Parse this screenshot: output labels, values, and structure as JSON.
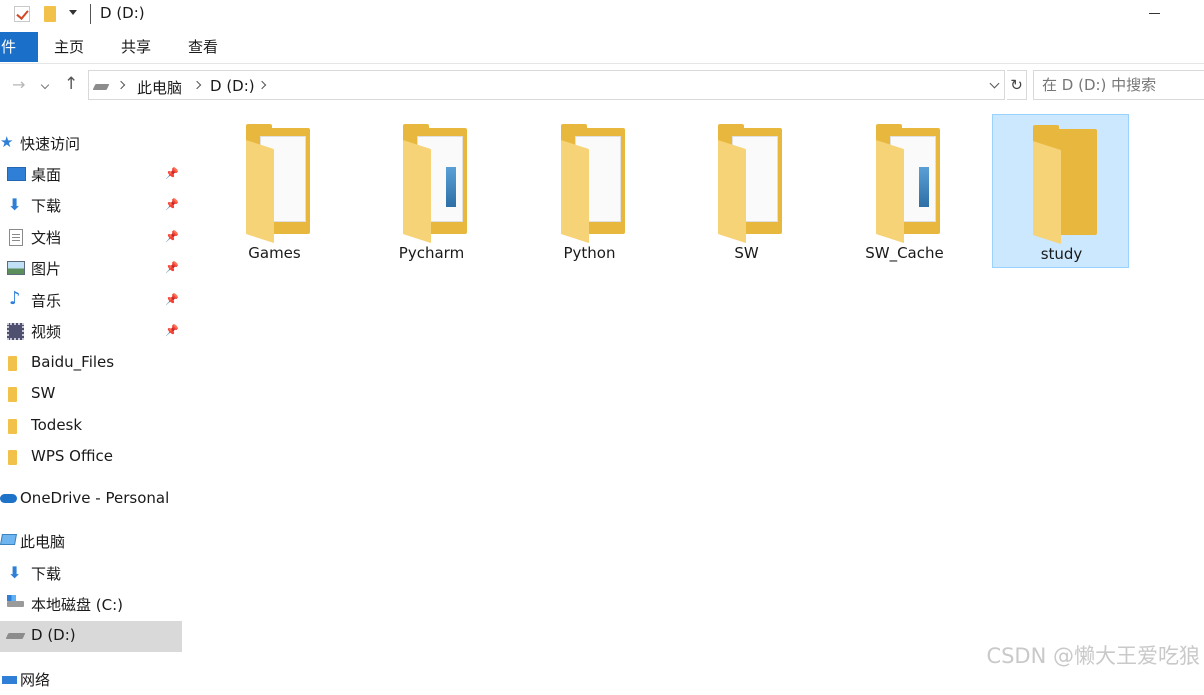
{
  "title_bar": {
    "title": "D (D:)"
  },
  "ribbon": {
    "tabs": [
      "件",
      "主页",
      "共享",
      "查看"
    ]
  },
  "address": {
    "crumbs": [
      "此电脑",
      "D (D:)"
    ],
    "search_placeholder": "在 D (D:) 中搜索"
  },
  "nav": {
    "quick_access": "快速访问",
    "items": [
      {
        "label": "桌面",
        "icon": "desktop-icon",
        "pinned": true
      },
      {
        "label": "下载",
        "icon": "download-icon",
        "pinned": true
      },
      {
        "label": "文档",
        "icon": "document-icon",
        "pinned": true
      },
      {
        "label": "图片",
        "icon": "picture-icon",
        "pinned": true
      },
      {
        "label": "音乐",
        "icon": "music-icon",
        "pinned": true
      },
      {
        "label": "视频",
        "icon": "video-icon",
        "pinned": true
      },
      {
        "label": "Baidu_Files",
        "icon": "folder-icon",
        "pinned": false
      },
      {
        "label": "SW",
        "icon": "folder-icon",
        "pinned": false
      },
      {
        "label": "Todesk",
        "icon": "folder-icon",
        "pinned": false
      },
      {
        "label": "WPS Office",
        "icon": "folder-icon",
        "pinned": false
      }
    ],
    "onedrive": "OneDrive - Personal",
    "this_pc": "此电脑",
    "pc_items": [
      {
        "label": "下载",
        "icon": "download-icon"
      },
      {
        "label": "本地磁盘 (C:)",
        "icon": "local-disk-icon"
      },
      {
        "label": "D (D:)",
        "icon": "drive-icon",
        "selected": true
      }
    ],
    "network": "网络"
  },
  "files": [
    {
      "name": "Games",
      "selected": false
    },
    {
      "name": "Pycharm",
      "selected": false
    },
    {
      "name": "Python",
      "selected": false
    },
    {
      "name": "SW",
      "selected": false
    },
    {
      "name": "SW_Cache",
      "selected": false
    },
    {
      "name": "study",
      "selected": true
    }
  ],
  "watermark": "CSDN @懒大王爱吃狼"
}
